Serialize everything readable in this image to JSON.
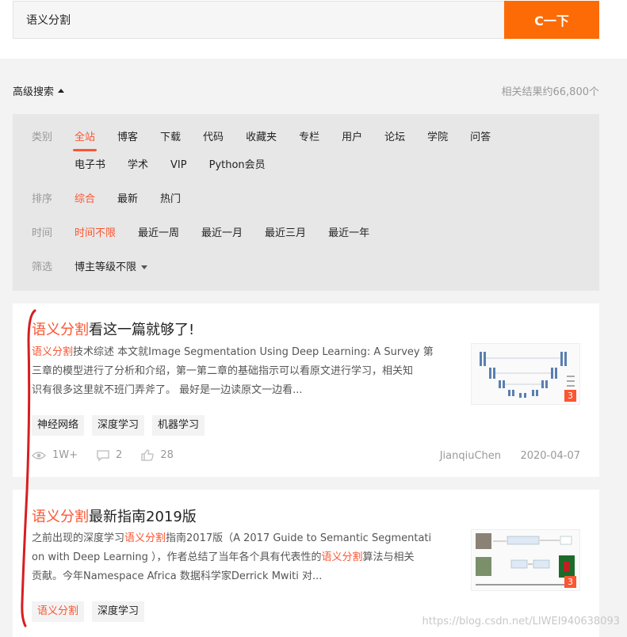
{
  "search": {
    "value": "语义分割",
    "button_label": "C一下"
  },
  "advanced": {
    "label": "高级搜索",
    "count_text": "相关结果约66,800个"
  },
  "filters": {
    "category": {
      "label": "类别",
      "items": [
        "全站",
        "博客",
        "下载",
        "代码",
        "收藏夹",
        "专栏",
        "用户",
        "论坛",
        "学院",
        "问答",
        "电子书",
        "学术",
        "VIP",
        "Python会员"
      ]
    },
    "sort": {
      "label": "排序",
      "items": [
        "综合",
        "最新",
        "热门"
      ]
    },
    "time": {
      "label": "时间",
      "items": [
        "时间不限",
        "最近一周",
        "最近一月",
        "最近三月",
        "最近一年"
      ]
    },
    "screen": {
      "label": "筛选",
      "value": "博主等级不限"
    }
  },
  "results": [
    {
      "title_hl": "语义分割",
      "title_rest": "看这一篇就够了!",
      "desc": [
        {
          "hl": "语义分割",
          "text": "技术综述 本文就Image Segmentation Using Deep Learning: A Survey 第"
        },
        {
          "hl": "",
          "text": "三章的模型进行了分析和介绍，第一第二章的基础指示可以看原文进行学习，相关知"
        },
        {
          "hl": "",
          "text": "识有很多这里就不班门弄斧了。 最好是一边读原文一边看..."
        }
      ],
      "thumb_badge": "3",
      "tags": [
        "神经网络",
        "深度学习",
        "机器学习"
      ],
      "views": "1W+",
      "comments": "2",
      "likes": "28",
      "author": "JianqiuChen",
      "date": "2020-04-07"
    },
    {
      "title_hl": "语义分割",
      "title_rest": "最新指南2019版",
      "desc": [
        {
          "pre": "之前出现的深度学习",
          "hl": "语义分割",
          "text": "指南2017版（A 2017 Guide to Semantic Segmentati"
        },
        {
          "pre": "on with Deep Learning ），作者总结了当年各个具有代表性的",
          "hl": "语义分割",
          "text": "算法与相关"
        },
        {
          "pre": "贡献。今年Namespace Africa 数据科学家Derrick Mwiti 对...",
          "hl": "",
          "text": ""
        }
      ],
      "thumb_badge": "3",
      "tags": [
        "语义分割",
        "深度学习"
      ]
    }
  ],
  "watermark": "https://blog.csdn.net/LIWEI940638093",
  "colors": {
    "accent": "#fc6b05",
    "highlight": "#fc5531",
    "annotation": "#d81e1e"
  }
}
